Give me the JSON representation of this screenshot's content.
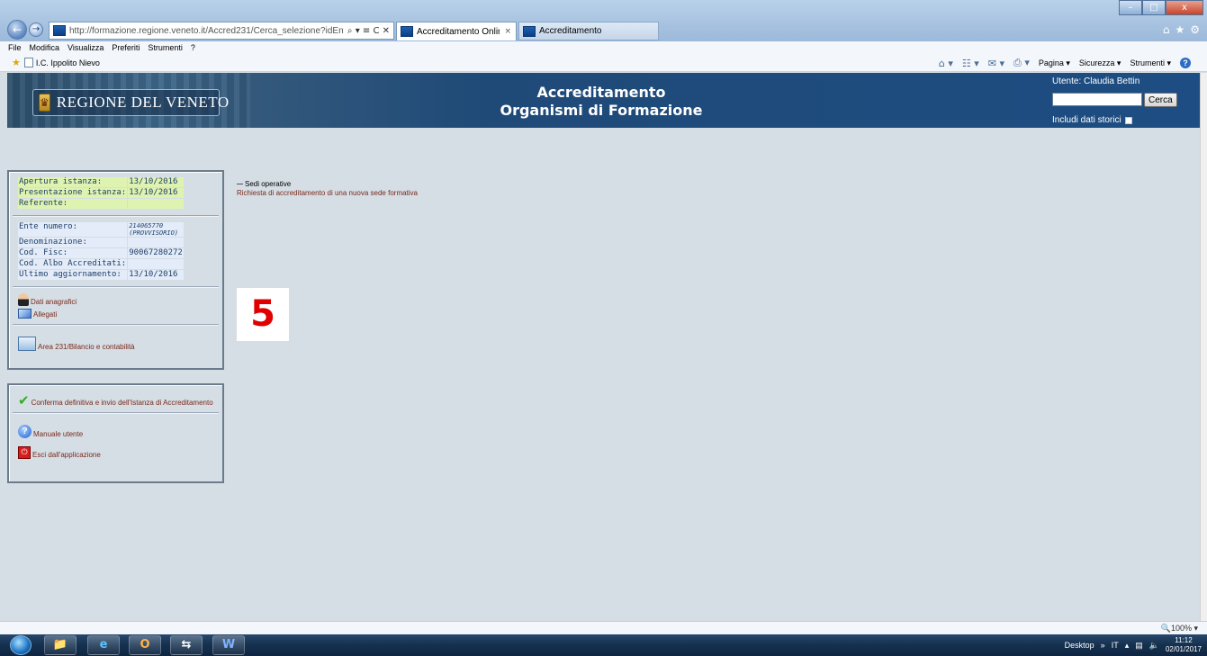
{
  "browser": {
    "url": "http://formazione.regione.veneto.it/Accred231/Cerca_selezione?idEnte=1432",
    "address_tools": "⌕ ▾ ≡ C ✕",
    "tabs": [
      {
        "label": "Accreditamento Online",
        "close": "×"
      },
      {
        "label": "Accreditamento"
      }
    ],
    "window_buttons": {
      "minimize": "–",
      "maximize": "□",
      "close": "x"
    },
    "chrome_icons": {
      "home": "⌂",
      "favorites": "★",
      "tools": "⚙"
    },
    "menu": [
      "File",
      "Modifica",
      "Visualizza",
      "Preferiti",
      "Strumenti",
      "?"
    ],
    "favorite": "I.C. Ippolito Nievo",
    "commands": [
      "Pagina ▾",
      "Sicurezza ▾",
      "Strumenti ▾"
    ],
    "zoom": "🔍100%  ▾"
  },
  "header": {
    "logo_text": "REGIONE DEL VENETO",
    "title_line1": "Accreditamento",
    "title_line2": "Organismi di Formazione",
    "user": "Utente: Claudia Bettin",
    "search_button": "Cerca",
    "storici_label": "Includi dati storici"
  },
  "istanza": [
    {
      "label": "Apertura istanza:",
      "value": "13/10/2016"
    },
    {
      "label": "Presentazione istanza:",
      "value": "13/10/2016"
    },
    {
      "label": "Referente:",
      "value": ""
    }
  ],
  "ente": {
    "numero_label": "Ente numero:",
    "numero_value": "214065770",
    "numero_note": "(PROVVISORIO)",
    "rows": [
      {
        "label": "Denominazione:",
        "value": ""
      },
      {
        "label": "Cod. Fisc:",
        "value": "90067280272"
      },
      {
        "label": "Cod. Albo Accreditati:",
        "value": ""
      },
      {
        "label": "Ultimo aggiornamento:",
        "value": "13/10/2016"
      }
    ]
  },
  "links": {
    "dati_anagrafici": "Dati anagrafici",
    "allegati": "Allegati",
    "area231": "Area 231/Bilancio e contabilità",
    "conferma": "Conferma definitiva e invio dell'Istanza di Accreditamento",
    "manuale": "Manuale utente",
    "esci": "Esci dall'applicazione"
  },
  "main": {
    "tree_heading": "Sedi operative",
    "tree_link": "Richiesta di accreditamento di una nuova sede formativa",
    "step_number": "5"
  },
  "taskbar": {
    "tray_desktop": "Desktop",
    "tray_chevron": "»",
    "tray_lang": "IT",
    "tray_icons": "▴",
    "time": "11:12",
    "date": "02/01/2017"
  },
  "colors": {
    "header_blue": "#1d4d82",
    "panel_bg": "#d5dde5",
    "green_cell": "#dff3b1",
    "blue_cell": "#e3ecf8",
    "link_red": "#7a2a1a",
    "step_red": "#e00000"
  }
}
